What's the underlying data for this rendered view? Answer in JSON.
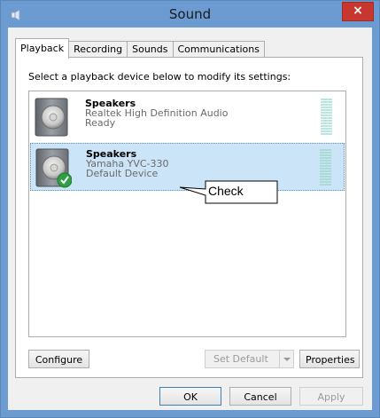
{
  "window": {
    "title": "Sound",
    "close_label": "×"
  },
  "tabs": [
    {
      "label": "Playback",
      "active": true
    },
    {
      "label": "Recording",
      "active": false
    },
    {
      "label": "Sounds",
      "active": false
    },
    {
      "label": "Communications",
      "active": false
    }
  ],
  "playback": {
    "instruction": "Select a playback device below to modify its settings:",
    "devices": [
      {
        "name": "Speakers",
        "driver": "Realtek High Definition Audio",
        "status": "Ready",
        "selected": false,
        "default_device": false
      },
      {
        "name": "Speakers",
        "driver": "Yamaha YVC-330",
        "status": "Default Device",
        "selected": true,
        "default_device": true
      }
    ],
    "callout": "Check",
    "buttons": {
      "configure": "Configure",
      "set_default": "Set Default",
      "properties": "Properties"
    }
  },
  "footer": {
    "ok": "OK",
    "cancel": "Cancel",
    "apply": "Apply"
  },
  "colors": {
    "title_bar": "#6b9bd1",
    "close_button": "#c7372f",
    "selection": "#cce4f7",
    "default_check": "#2ea043"
  }
}
